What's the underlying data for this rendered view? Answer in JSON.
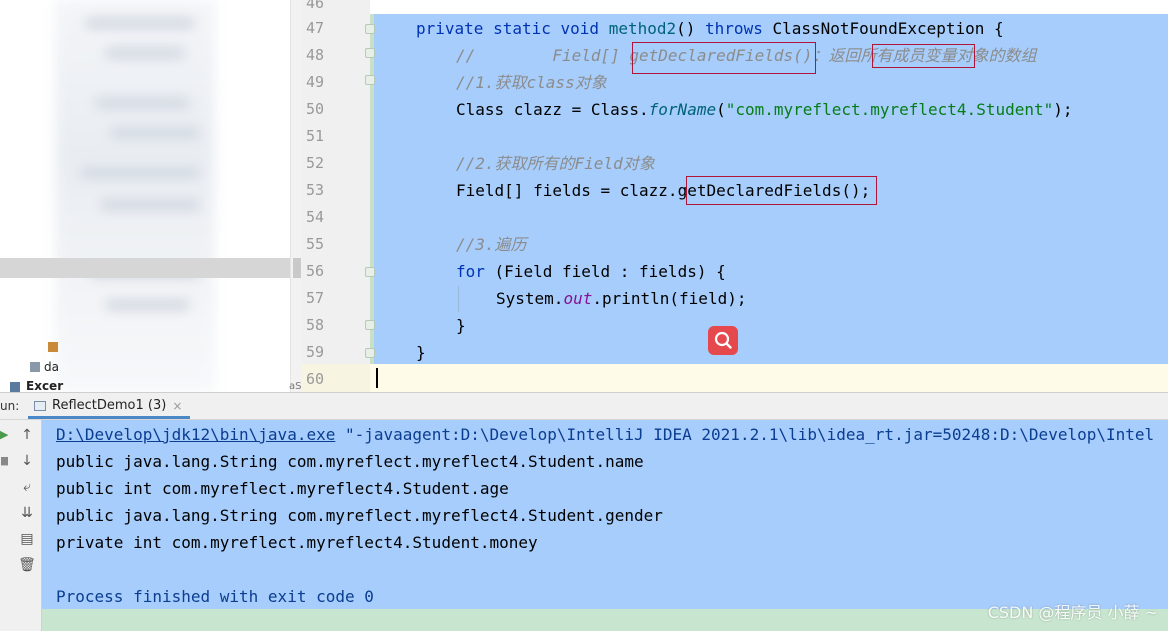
{
  "project_tree": {
    "items": [
      {
        "label": "da"
      },
      {
        "label": "Excer"
      }
    ]
  },
  "editor": {
    "lines": [
      {
        "n": "46"
      },
      {
        "n": "47"
      },
      {
        "n": "48"
      },
      {
        "n": "49"
      },
      {
        "n": "50"
      },
      {
        "n": "51"
      },
      {
        "n": "52"
      },
      {
        "n": "53"
      },
      {
        "n": "54"
      },
      {
        "n": "55"
      },
      {
        "n": "56"
      },
      {
        "n": "57"
      },
      {
        "n": "58"
      },
      {
        "n": "59"
      },
      {
        "n": "60"
      }
    ],
    "code": {
      "l47_private": "private",
      "l47_static": "static",
      "l47_void": "void",
      "l47_name": "method2",
      "l47_paren": "()",
      "l47_throws": "throws",
      "l47_rest": "ClassNotFoundException {",
      "l48_comment_a": "//        Field[] ",
      "l48_comment_b": "getDeclaredFields",
      "l48_comment_c": "()：返回",
      "l48_comment_d": "所有成员变量",
      "l48_comment_e": "对象的数组",
      "l49_comment": "//1.获取class对象",
      "l50_a": "Class clazz = Class.",
      "l50_b": "forName",
      "l50_c": "(",
      "l50_str": "\"com.myreflect.myreflect4.Student\"",
      "l50_d": ");",
      "l52_comment": "//2.获取所有的Field对象",
      "l53_a": "Field[] fields = clazz.",
      "l53_b": "getDeclaredFields()",
      "l53_c": ";",
      "l55_comment": "//3.遍历",
      "l56_for": "for",
      "l56_rest": " (Field field : fields) {",
      "l57_a": "System.",
      "l57_out": "out",
      "l57_b": ".println(field);",
      "l58": "}",
      "l59": "}"
    }
  },
  "run_panel": {
    "label": "un:",
    "tab_title": "ReflectDemo1 (3)",
    "tab_close": "×",
    "console": {
      "java_path": "D:\\Develop\\jdk12\\bin\\java.exe",
      "args": " \"-javaagent:D:\\Develop\\IntelliJ IDEA 2021.2.1\\lib\\idea_rt.jar=50248:D:\\Develop\\Intel",
      "out1": "public java.lang.String com.myreflect.myreflect4.Student.name",
      "out2": "public int com.myreflect.myreflect4.Student.age",
      "out3": "public java.lang.String com.myreflect.myreflect4.Student.gender",
      "out4": "private int com.myreflect.myreflect4.Student.money",
      "exit": "Process finished with exit code 0"
    }
  },
  "watermark": "CSDN @程序员 小薛 ~",
  "icons": [
    "up-arrow-icon",
    "down-arrow-icon",
    "soft-wrap-icon",
    "scroll-to-end-icon",
    "print-icon",
    "trash-icon",
    "search-icon"
  ],
  "colors": {
    "selection": "#a6cdfb",
    "console_bg": "#c8e6cf",
    "highlight_box": "#b0153a",
    "search_btn": "#e5484d"
  }
}
